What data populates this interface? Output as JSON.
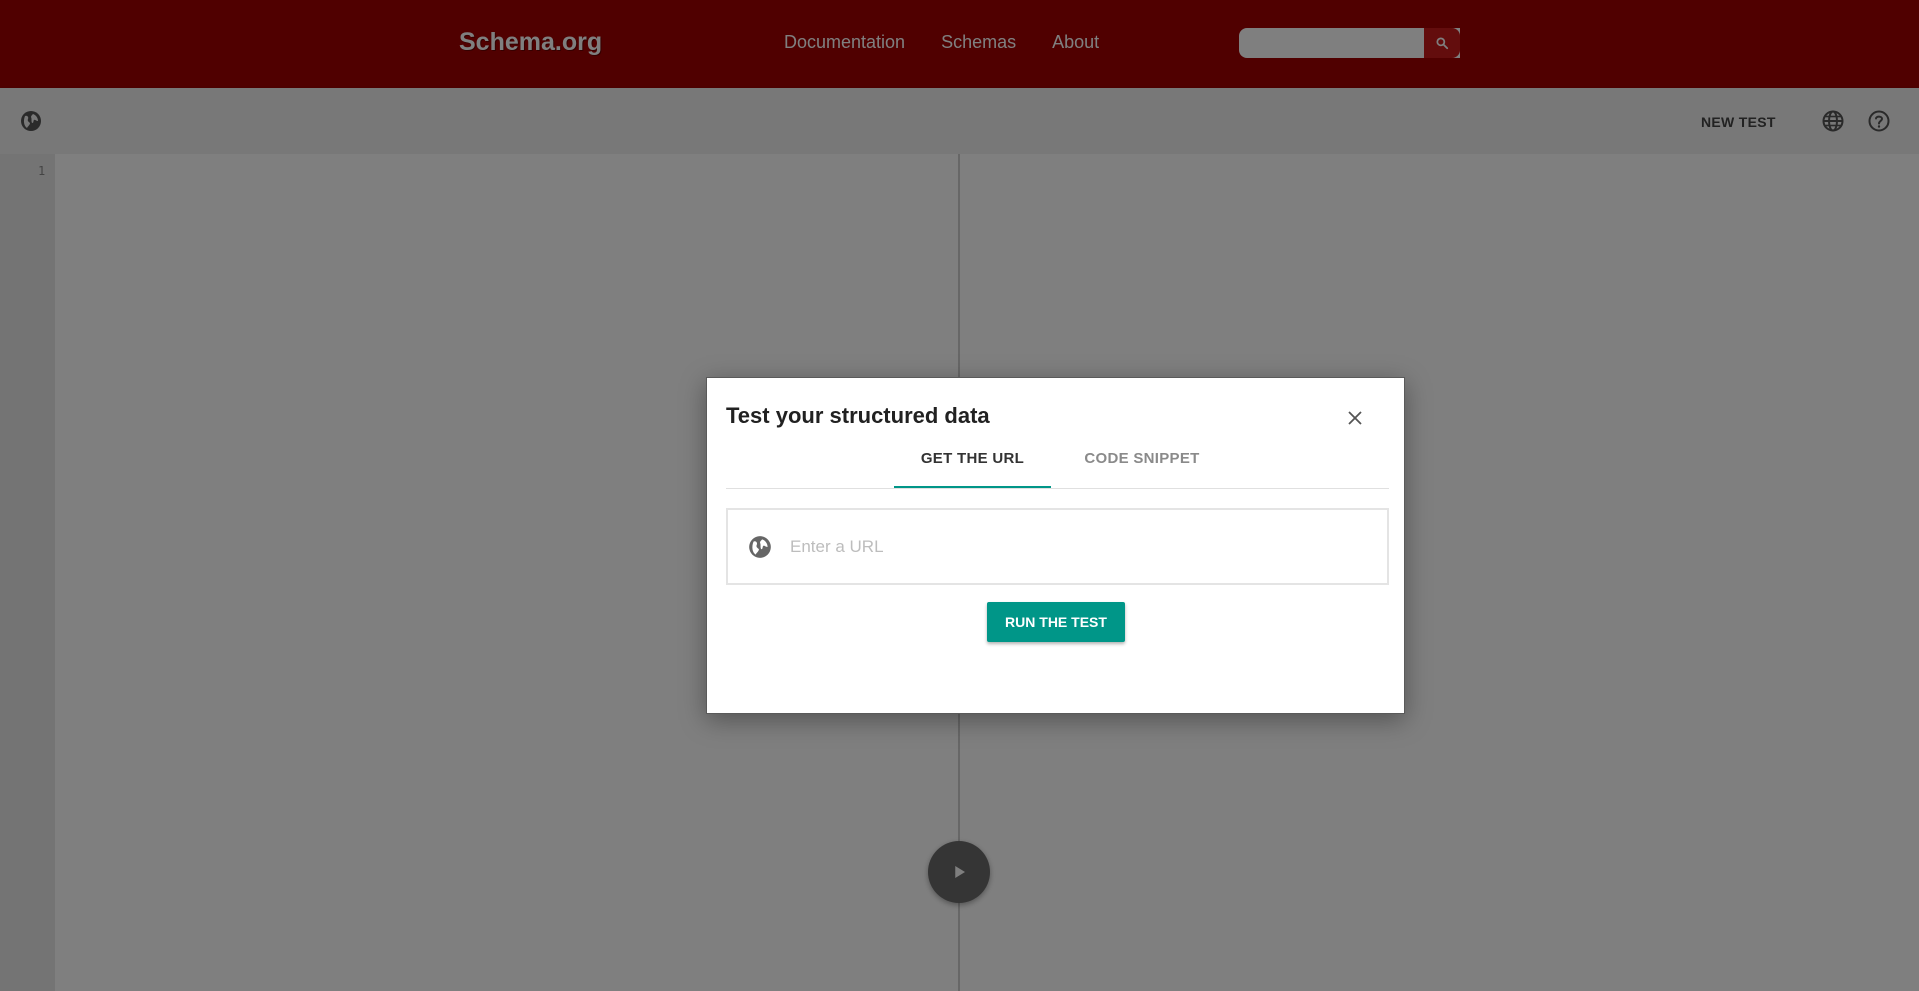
{
  "header": {
    "logo": "Schema.org",
    "nav": [
      "Documentation",
      "Schemas",
      "About"
    ],
    "search_placeholder": ""
  },
  "toolbar": {
    "new_test_label": "NEW TEST"
  },
  "editor": {
    "line_numbers": [
      "1"
    ]
  },
  "dialog": {
    "title": "Test your structured data",
    "tabs": [
      {
        "label": "GET THE URL",
        "active": true
      },
      {
        "label": "CODE SNIPPET",
        "active": false
      }
    ],
    "url_placeholder": "Enter a URL",
    "url_value": "",
    "run_button_label": "RUN THE TEST"
  },
  "colors": {
    "header_bg": "#a00000",
    "accent": "#009688"
  },
  "icons": [
    "search-icon",
    "globe-icon",
    "language-icon",
    "help-icon",
    "close-icon",
    "play-icon"
  ]
}
